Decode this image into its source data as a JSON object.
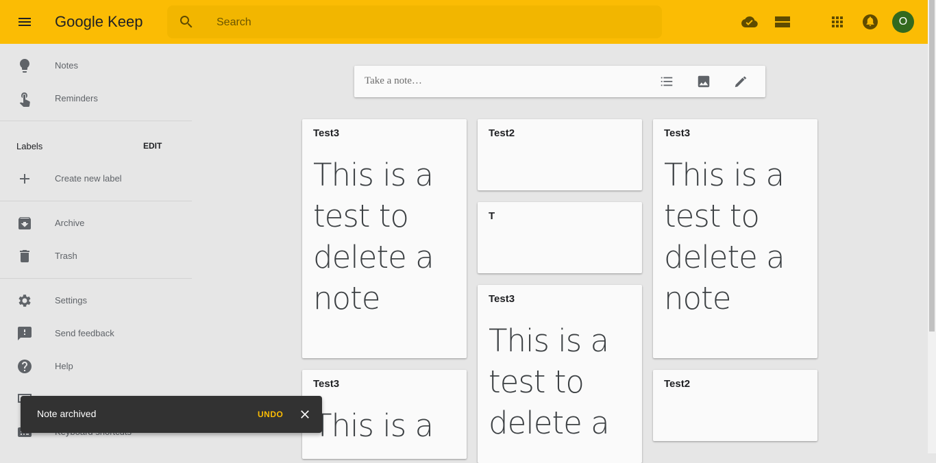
{
  "app": {
    "logo_text": "Google Keep",
    "avatar_letter": "O"
  },
  "colors": {
    "header": "#fbbc04",
    "search_bg": "#f2b600",
    "avatar": "#33691e",
    "undo": "#fbbc04"
  },
  "search": {
    "placeholder": "Search"
  },
  "header_icons": [
    "menu-icon",
    "search-icon",
    "cloud-done-icon",
    "list-view-icon",
    "apps-icon",
    "notifications-icon"
  ],
  "sidebar": {
    "notes": "Notes",
    "reminders": "Reminders",
    "labels_heading": "Labels",
    "edit_label": "EDIT",
    "create_label": "Create new label",
    "archive": "Archive",
    "trash": "Trash",
    "settings": "Settings",
    "feedback": "Send feedback",
    "help": "Help",
    "shortcuts": "Keyboard shortcuts"
  },
  "composer": {
    "placeholder": "Take a note…"
  },
  "notes": [
    {
      "title": "Test3",
      "body": "This is a test to delete a note"
    },
    {
      "title": "Test3",
      "body": "This is a"
    },
    {
      "title": "Test2",
      "body": ""
    },
    {
      "title": "T",
      "body": ""
    },
    {
      "title": "Test3",
      "body": "This is a test to delete a"
    },
    {
      "title": "Test3",
      "body": "This is a test to delete a note"
    },
    {
      "title": "Test2",
      "body": ""
    }
  ],
  "snackbar": {
    "message": "Note archived",
    "undo": "UNDO"
  }
}
